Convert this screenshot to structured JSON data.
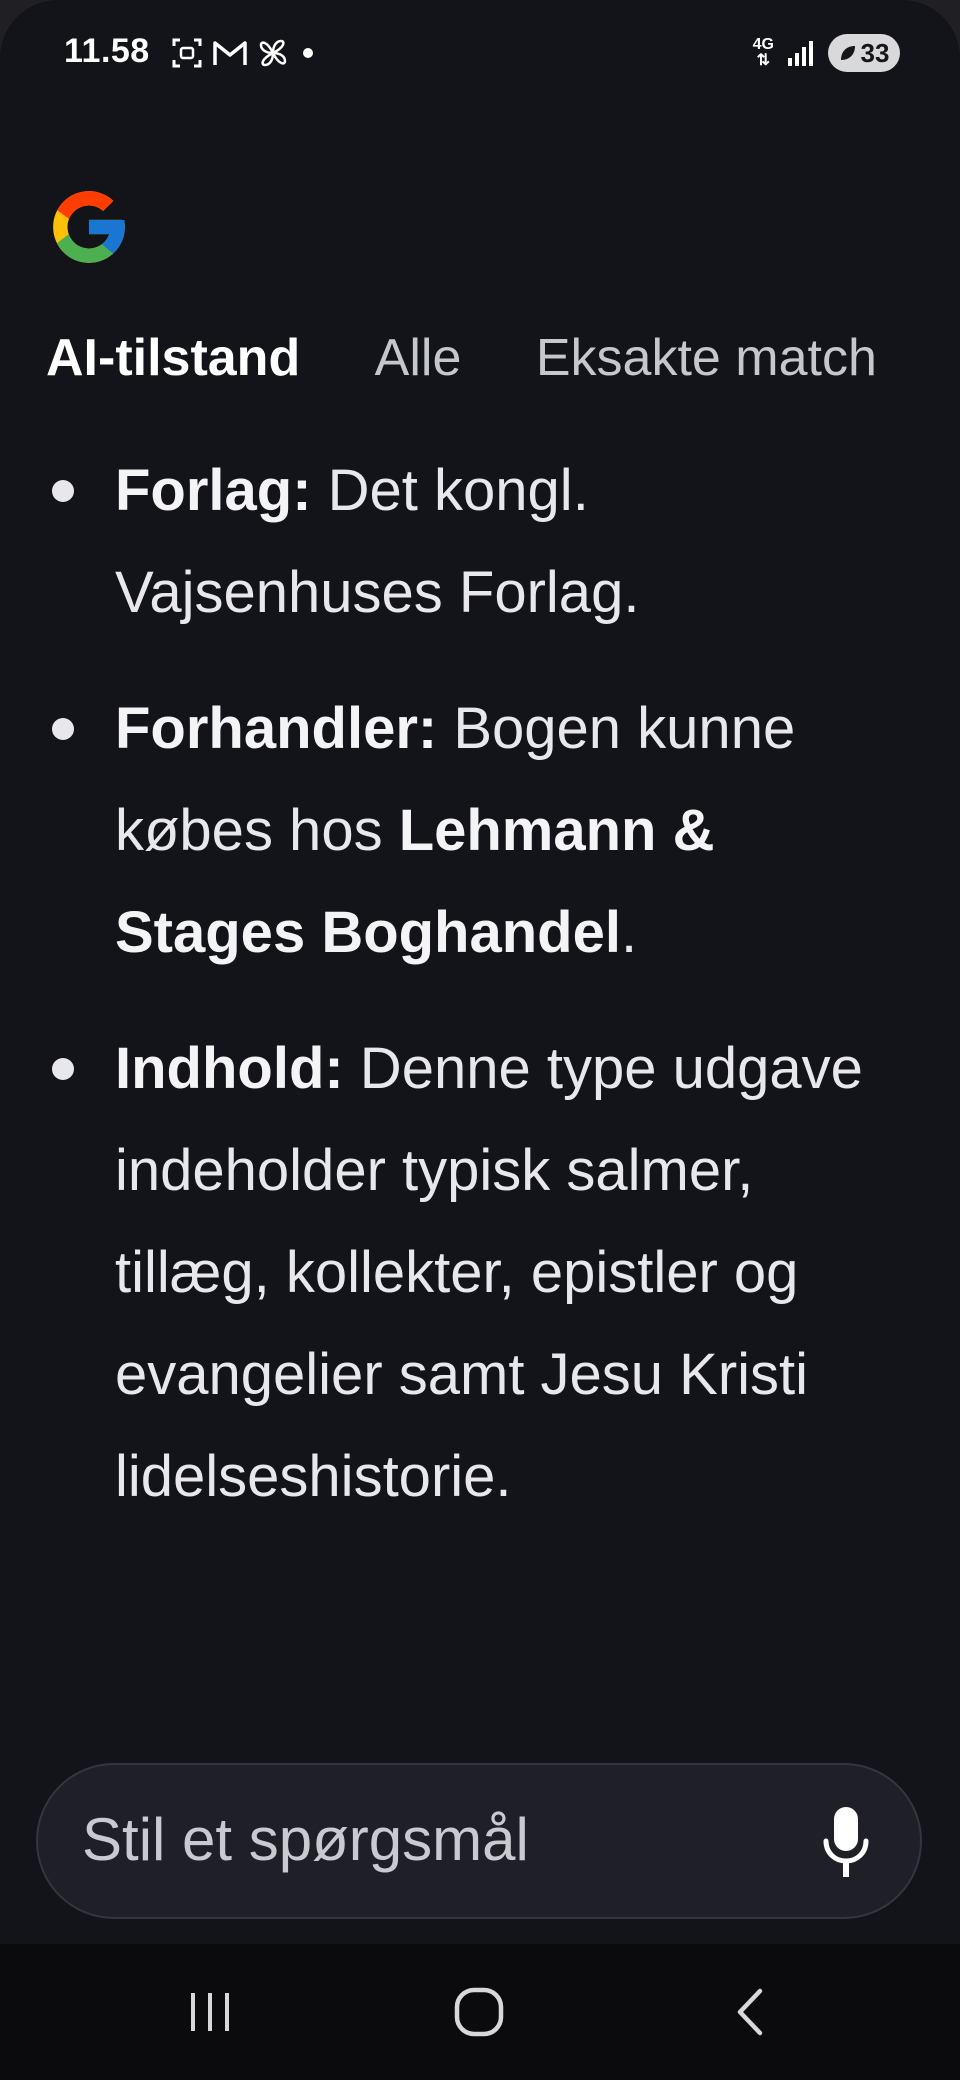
{
  "status_bar": {
    "time": "11.58",
    "network": "4G",
    "battery": "33",
    "icons_left": [
      "screenshot-icon",
      "gmail-icon",
      "pinwheel-icon",
      "dot-icon"
    ],
    "icons_right": [
      "4g-icon",
      "signal-icon",
      "battery-icon"
    ]
  },
  "tabs": [
    {
      "label": "AI-tilstand",
      "active": true
    },
    {
      "label": "Alle",
      "active": false
    },
    {
      "label": "Eksakte match",
      "active": false
    }
  ],
  "items": [
    {
      "label": "Forlag:",
      "text": " Det kongl. Vajsenhuses Forlag."
    },
    {
      "label": "Forhandler:",
      "text_before": " Bogen kunne købes hos ",
      "bold": "Lehmann & Stages Boghandel",
      "text_after": "."
    },
    {
      "label": "Indhold:",
      "text": " Denne type udgave indeholder typisk salmer, tillæg, kollekter, epistler og evangelier samt Jesu Kristi lidelseshistorie."
    }
  ],
  "ask_bar": {
    "placeholder": "Stil et spørgsmål"
  },
  "nav": [
    "recent-apps-icon",
    "home-icon",
    "back-icon"
  ],
  "colors": {
    "background": "#131419",
    "text": "#e8e8ec",
    "tab_inactive": "#c4c7cc",
    "input_bg": "#1e1f27"
  }
}
